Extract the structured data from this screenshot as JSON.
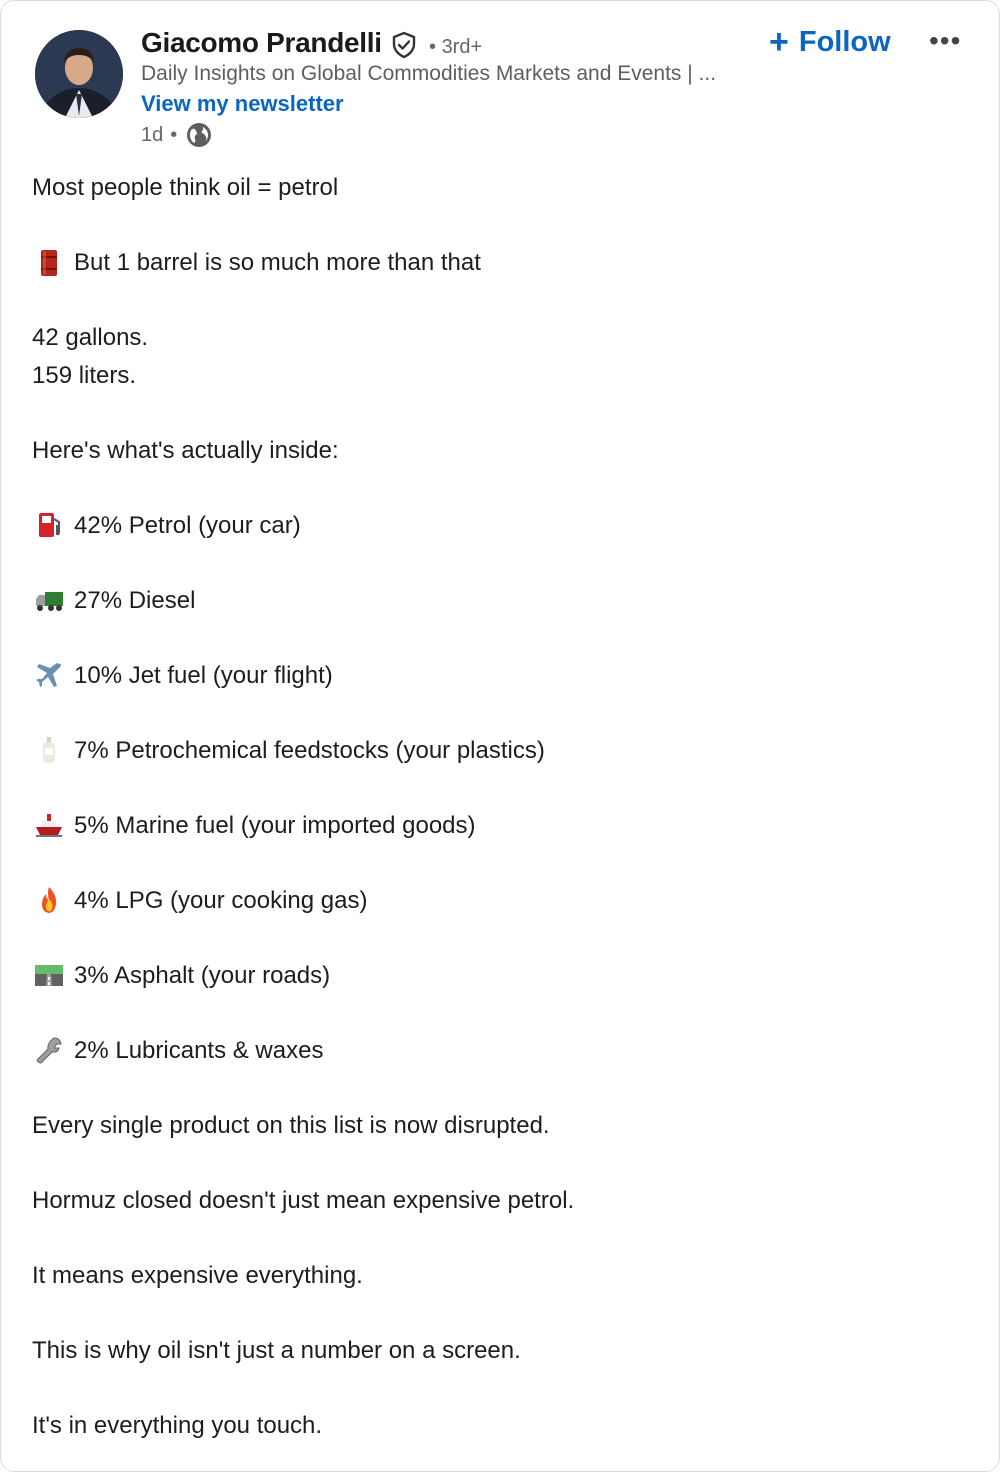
{
  "post": {
    "author": {
      "name": "Giacomo Prandelli",
      "degree": "3rd+",
      "headline": "Daily Insights on Global Commodities Markets and Events | ...",
      "newsletter_link": "View my newsletter",
      "timestamp": "1d",
      "verified_icon": "shield-check-icon",
      "visibility_icon": "globe-icon"
    },
    "actions": {
      "follow_label": "Follow",
      "follow_icon": "plus-icon",
      "more_icon": "ellipsis-icon"
    },
    "body": {
      "intro": "Most people think oil = petrol",
      "barrel_line": "But 1 barrel is so much more than that",
      "gallons": "42 gallons.",
      "liters": "159 liters.",
      "inside_heading": "Here's what's actually inside:",
      "breakdown": [
        {
          "icon": "fuel-pump-icon",
          "text": "42% Petrol (your car)"
        },
        {
          "icon": "truck-icon",
          "text": "27% Diesel"
        },
        {
          "icon": "airplane-icon",
          "text": "10% Jet fuel (your flight)"
        },
        {
          "icon": "lotion-bottle-icon",
          "text": "7% Petrochemical feedstocks (your plastics)"
        },
        {
          "icon": "ship-icon",
          "text": "5% Marine fuel (your imported goods)"
        },
        {
          "icon": "fire-icon",
          "text": "4% LPG (your cooking gas)"
        },
        {
          "icon": "road-icon",
          "text": "3% Asphalt (your roads)"
        },
        {
          "icon": "wrench-icon",
          "text": "2% Lubricants & waxes"
        }
      ],
      "closing": [
        "Every single product on this list is now disrupted.",
        "Hormuz closed doesn't just mean expensive petrol.",
        "It means expensive everything.",
        "This is why oil isn't just a number on a screen.",
        "It's in everything you touch."
      ]
    },
    "colors": {
      "link_blue": "#0a66c2",
      "text": "#1d1d1d",
      "muted": "#666666"
    }
  }
}
